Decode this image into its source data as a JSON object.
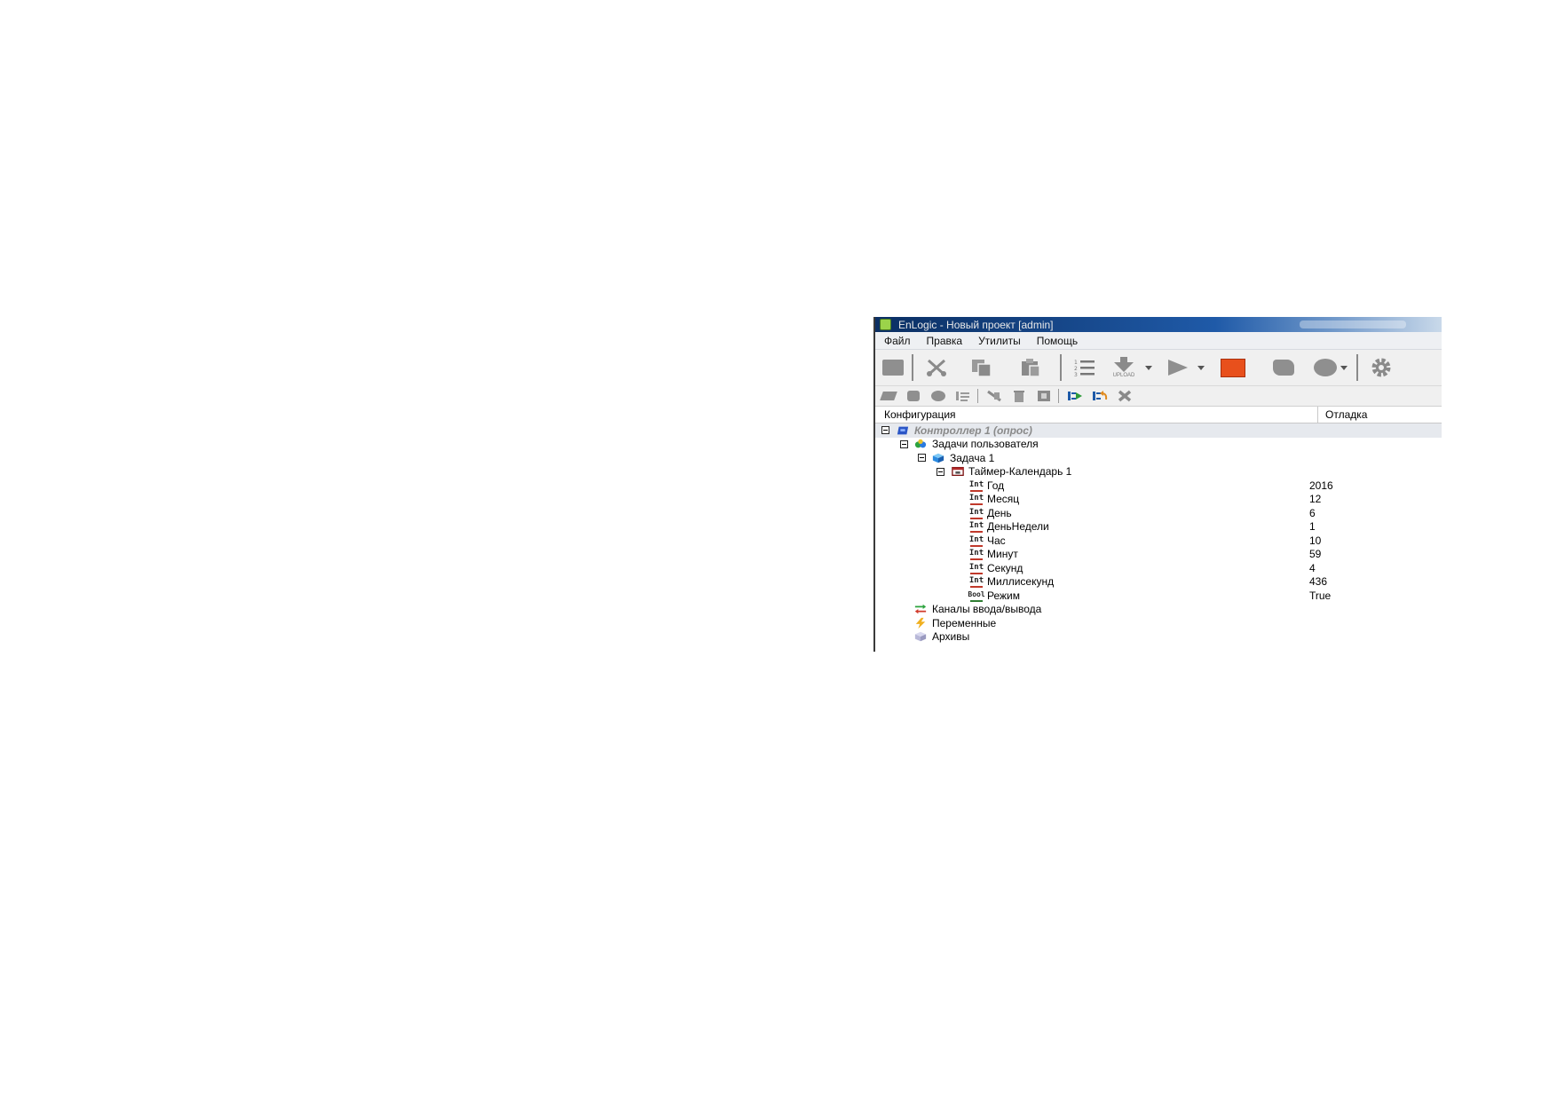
{
  "window": {
    "title": "EnLogic - Новый проект [admin]"
  },
  "menu": {
    "items": [
      "Файл",
      "Правка",
      "Утилиты",
      "Помощь"
    ]
  },
  "toolbar": {
    "upload_label": "UPLOAD",
    "colors": {
      "stop": "#e8501c",
      "icon_gray": "#8f8f8f"
    }
  },
  "tree": {
    "header": {
      "config": "Конфигурация",
      "debug": "Отладка"
    },
    "controller": "Контроллер 1 (опрос)",
    "user_tasks": "Задачи пользователя",
    "task": "Задача 1",
    "timer": "Таймер-Календарь 1",
    "params": [
      {
        "type": "Int",
        "name": "Год",
        "value": "2016"
      },
      {
        "type": "Int",
        "name": "Месяц",
        "value": "12"
      },
      {
        "type": "Int",
        "name": "День",
        "value": "6"
      },
      {
        "type": "Int",
        "name": "ДеньНедели",
        "value": "1"
      },
      {
        "type": "Int",
        "name": "Час",
        "value": "10"
      },
      {
        "type": "Int",
        "name": "Минут",
        "value": "59"
      },
      {
        "type": "Int",
        "name": "Секунд",
        "value": "4"
      },
      {
        "type": "Int",
        "name": "Миллисекунд",
        "value": "436"
      },
      {
        "type": "Bool",
        "name": "Режим",
        "value": "True"
      }
    ],
    "io_channels": "Каналы ввода/вывода",
    "variables": "Переменные",
    "archives": "Архивы"
  }
}
